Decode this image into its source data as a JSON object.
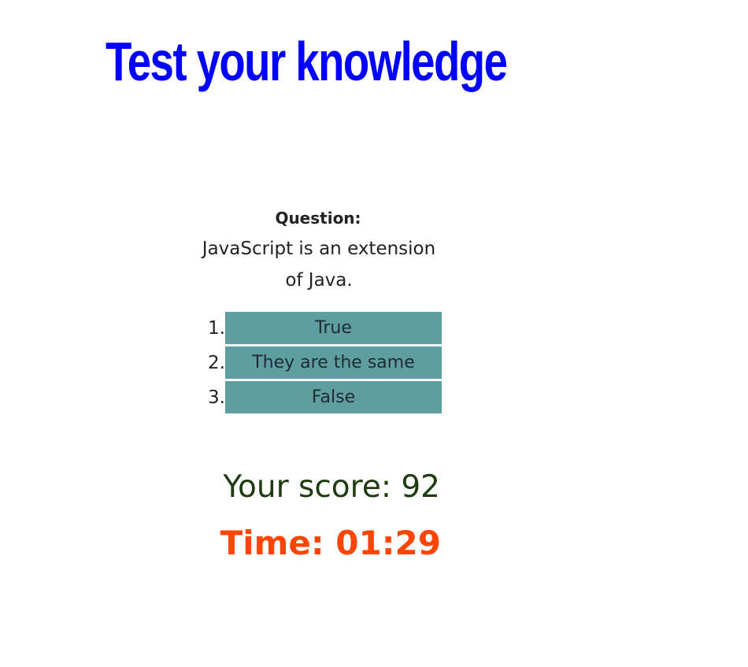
{
  "page": {
    "title": "Test your knowledge"
  },
  "quiz": {
    "question_label": "Question:",
    "question_text": "JavaScript is an extension of Java.",
    "answers": [
      {
        "number": "1.",
        "label": "True"
      },
      {
        "number": "2.",
        "label": "They are the same"
      },
      {
        "number": "3.",
        "label": "False"
      }
    ]
  },
  "status": {
    "score_text": "Your score: 92",
    "time_text": "Time: 01:29"
  },
  "colors": {
    "title": "#0000ff",
    "answer_button_background": "#5f9ea0",
    "score_text": "#1f3b10",
    "time_text": "#ff4500"
  }
}
